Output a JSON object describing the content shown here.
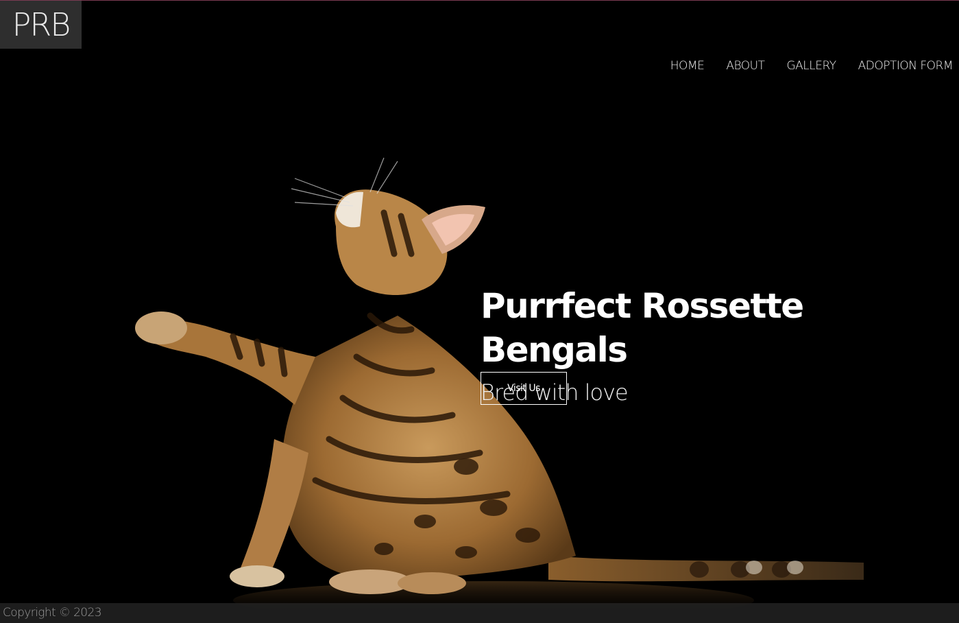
{
  "brand": {
    "logo_text": "PRB"
  },
  "nav": {
    "items": [
      {
        "label": "HOME"
      },
      {
        "label": "ABOUT"
      },
      {
        "label": "GALLERY"
      },
      {
        "label": "ADOPTION FORM"
      }
    ]
  },
  "hero": {
    "title": "Purrfect Rossette Bengals",
    "subtitle": "Bred with love",
    "button_label": "Visit Us"
  },
  "footer": {
    "copyright": "Copyright © 2023"
  },
  "colors": {
    "background": "#000000",
    "logo_bg": "#2e2e2e",
    "text": "#ffffff",
    "footer_text": "#9a9a9a"
  }
}
